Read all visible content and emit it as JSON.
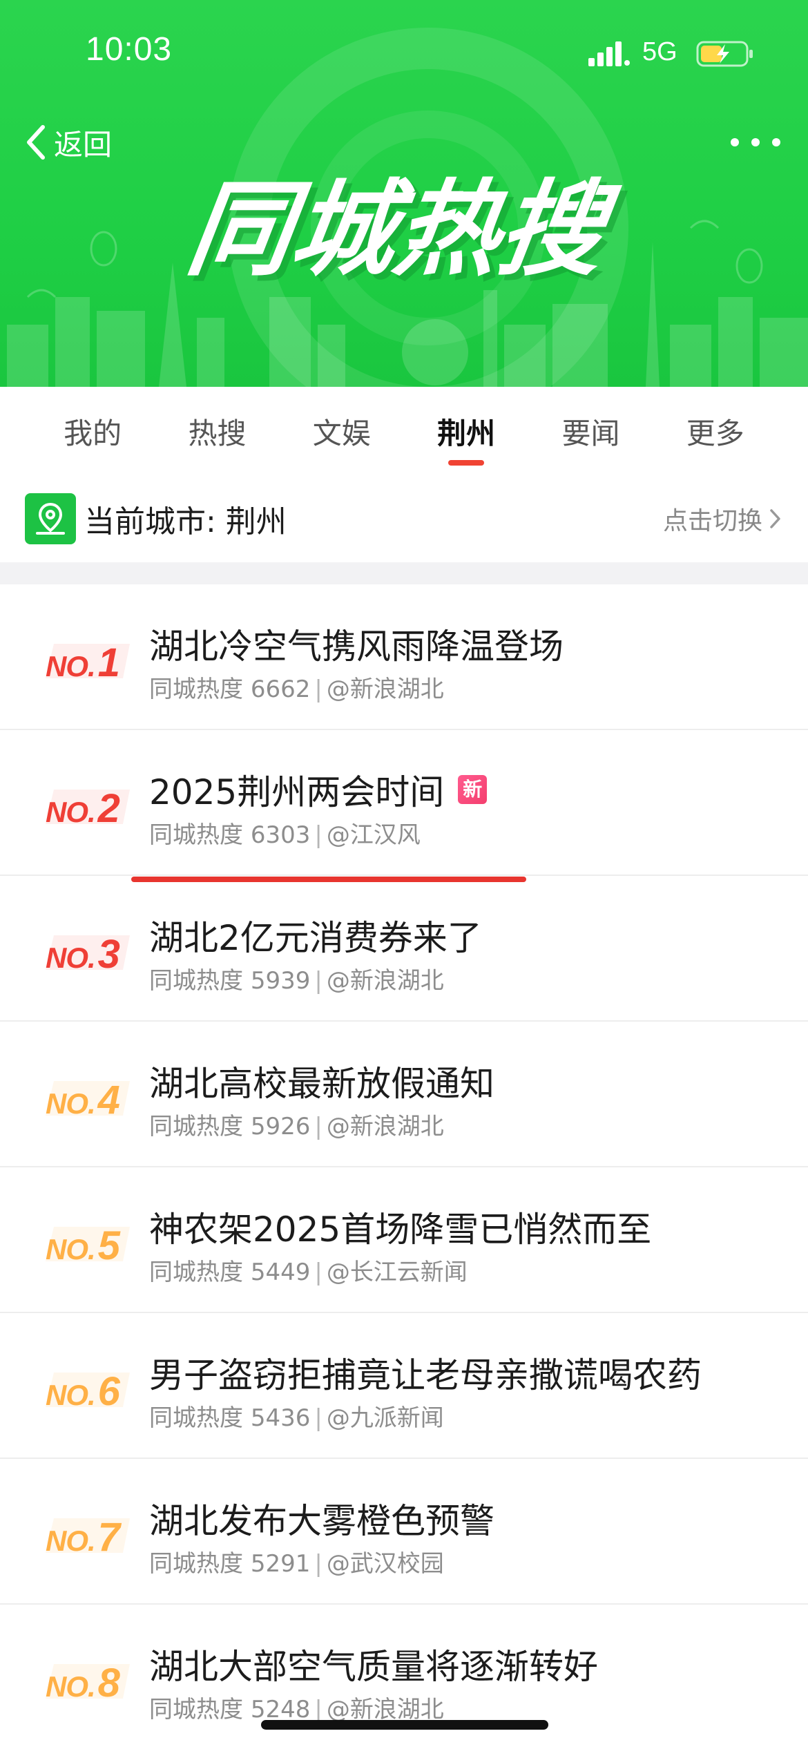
{
  "status_bar": {
    "time": "10:03",
    "network": "5G",
    "signal_icon": "signal-bars-icon",
    "battery_icon": "battery-charging-icon"
  },
  "nav": {
    "back_label": "返回",
    "more_icon": "more-dots-icon"
  },
  "banner": {
    "title": "同城热搜",
    "background_color": "#1fcf45"
  },
  "tabs": [
    {
      "label": "我的",
      "active": false
    },
    {
      "label": "热搜",
      "active": false
    },
    {
      "label": "文娱",
      "active": false
    },
    {
      "label": "荆州",
      "active": true
    },
    {
      "label": "要闻",
      "active": false
    },
    {
      "label": "更多",
      "active": false
    }
  ],
  "city": {
    "label": "当前城市: 荆州",
    "switch_label": "点击切换",
    "icon": "location-pin-icon"
  },
  "colors": {
    "accent_red": "#ef3f36",
    "rank_warm": "#ffb046",
    "new_badge": "#f43f6e"
  },
  "list": [
    {
      "rank_prefix": "NO.",
      "rank": "1",
      "title": "湖北冷空气携风雨降温登场",
      "heat_label": "同城热度",
      "heat": "6662",
      "source": "@新浪湖北",
      "new": false,
      "tier": "hot"
    },
    {
      "rank_prefix": "NO.",
      "rank": "2",
      "title": "2025荆州两会时间",
      "heat_label": "同城热度",
      "heat": "6303",
      "source": "@江汉风",
      "new": true,
      "new_label": "新",
      "tier": "hot"
    },
    {
      "rank_prefix": "NO.",
      "rank": "3",
      "title": "湖北2亿元消费券来了",
      "heat_label": "同城热度",
      "heat": "5939",
      "source": "@新浪湖北",
      "new": false,
      "tier": "hot"
    },
    {
      "rank_prefix": "NO.",
      "rank": "4",
      "title": "湖北高校最新放假通知",
      "heat_label": "同城热度",
      "heat": "5926",
      "source": "@新浪湖北",
      "new": false,
      "tier": "warm"
    },
    {
      "rank_prefix": "NO.",
      "rank": "5",
      "title": "神农架2025首场降雪已悄然而至",
      "heat_label": "同城热度",
      "heat": "5449",
      "source": "@长江云新闻",
      "new": false,
      "tier": "warm"
    },
    {
      "rank_prefix": "NO.",
      "rank": "6",
      "title": "男子盗窃拒捕竟让老母亲撒谎喝农药",
      "heat_label": "同城热度",
      "heat": "5436",
      "source": "@九派新闻",
      "new": false,
      "tier": "warm"
    },
    {
      "rank_prefix": "NO.",
      "rank": "7",
      "title": "湖北发布大雾橙色预警",
      "heat_label": "同城热度",
      "heat": "5291",
      "source": "@武汉校园",
      "new": false,
      "tier": "warm"
    },
    {
      "rank_prefix": "NO.",
      "rank": "8",
      "title": "湖北大部空气质量将逐渐转好",
      "heat_label": "同城热度",
      "heat": "5248",
      "source": "@新浪湖北",
      "new": false,
      "tier": "warm"
    }
  ]
}
